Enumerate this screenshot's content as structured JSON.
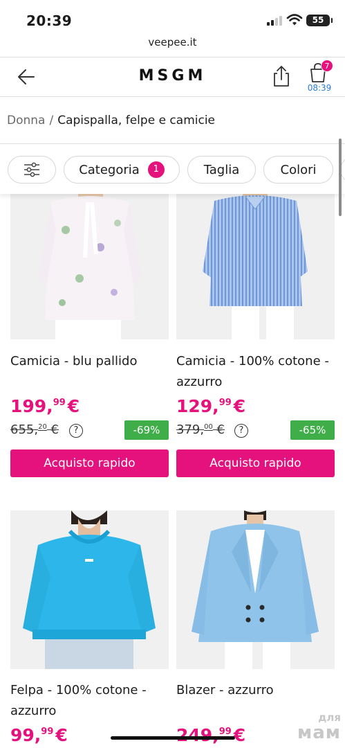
{
  "status_bar": {
    "time": "20:39",
    "battery": "55"
  },
  "browser": {
    "url": "veepee.it"
  },
  "header": {
    "brand": "MSGM",
    "cart_count": "7",
    "cart_timer": "08:39"
  },
  "breadcrumb": {
    "home": "Donna",
    "separator": "/",
    "current": "Capispalla, felpe e camicie"
  },
  "filters": {
    "categoria_label": "Categoria",
    "categoria_count": "1",
    "taglia_label": "Taglia",
    "colori_label": "Colori"
  },
  "products": [
    {
      "name": "Camicia - blu pallido",
      "price_int": "199,",
      "price_dec": "99",
      "currency": "€",
      "old_int": "655,",
      "old_dec": "20",
      "old_currency": "€",
      "discount": "-69%",
      "buy_label": "Acquisto rapido",
      "help_label": "?"
    },
    {
      "name": "Camicia - 100% cotone - azzurro",
      "price_int": "129,",
      "price_dec": "99",
      "currency": "€",
      "old_int": "379,",
      "old_dec": "00",
      "old_currency": "€",
      "discount": "-65%",
      "buy_label": "Acquisto rapido",
      "help_label": "?"
    },
    {
      "name": "Felpa - 100% cotone - azzurro",
      "price_int": "99,",
      "price_dec": "99",
      "currency": "€"
    },
    {
      "name": "Blazer - azzurro",
      "price_int": "249,",
      "price_dec": "99",
      "currency": "€"
    }
  ],
  "watermark": {
    "line1": "для",
    "line2": "мам"
  },
  "colors": {
    "accent": "#e5127d",
    "discount": "#3fae49",
    "link": "#2a7bd6"
  },
  "icons": [
    "back-arrow-icon",
    "share-icon",
    "cart-icon",
    "sliders-icon",
    "signal-icon",
    "wifi-icon",
    "battery-icon"
  ]
}
